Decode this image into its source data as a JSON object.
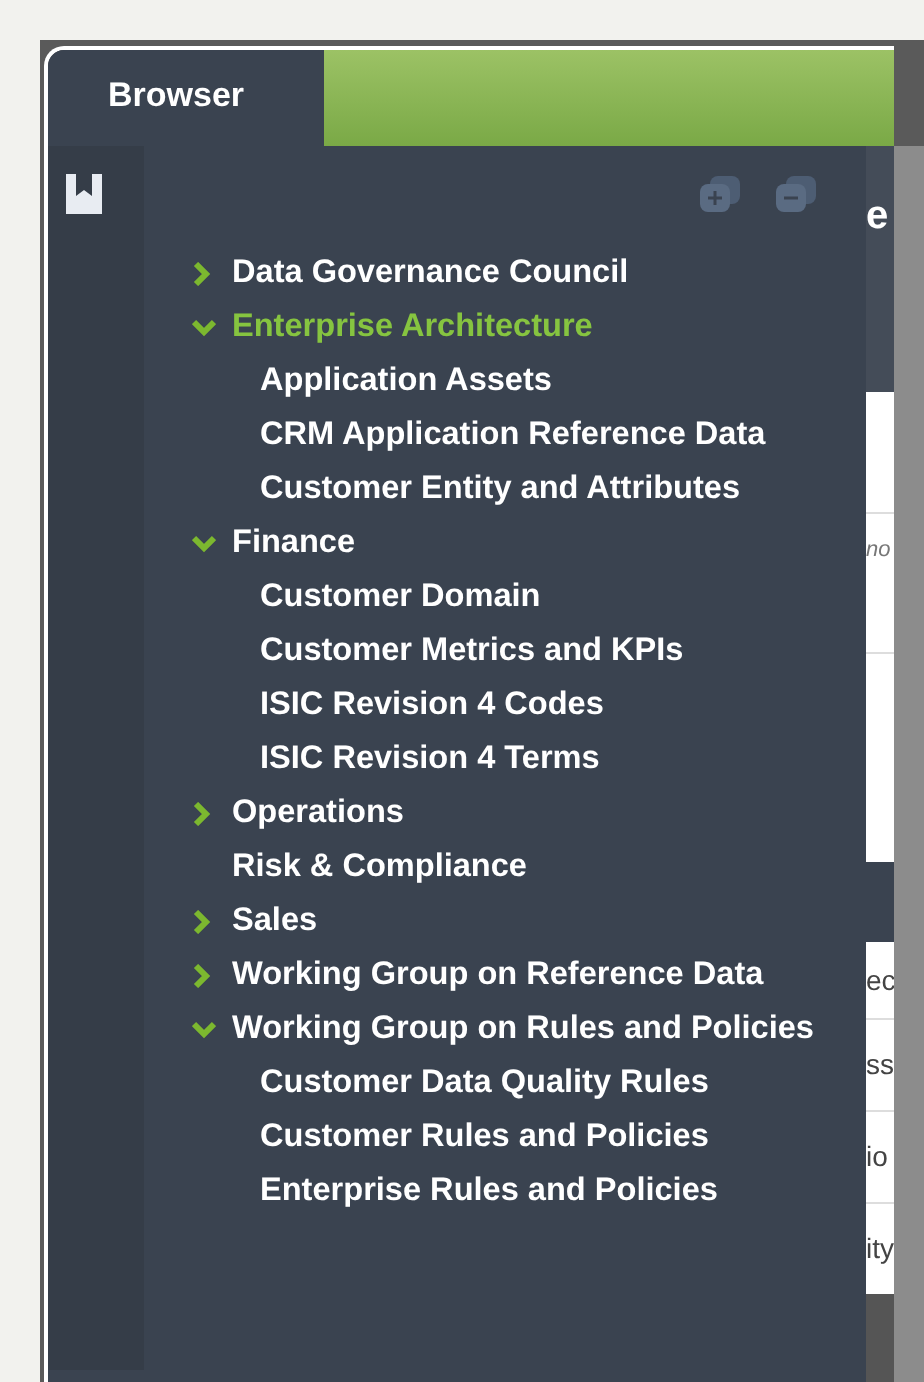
{
  "tabs": [
    {
      "label": "Browser",
      "selected": true
    }
  ],
  "tree": [
    {
      "label": "Data Governance Council",
      "expanded": false,
      "selected": false,
      "has_children": true
    },
    {
      "label": "Enterprise Architecture",
      "expanded": true,
      "selected": true,
      "has_children": true,
      "children": [
        {
          "label": "Application Assets",
          "selected": false
        },
        {
          "label": "CRM Application Reference Data",
          "selected": false
        },
        {
          "label": "Customer Entity and Attributes",
          "selected": false
        }
      ]
    },
    {
      "label": "Finance",
      "expanded": true,
      "selected": false,
      "has_children": true,
      "children": [
        {
          "label": "Customer Domain",
          "selected": false
        },
        {
          "label": "Customer Metrics and KPIs",
          "selected": false
        },
        {
          "label": "ISIC Revision 4 Codes",
          "selected": false
        },
        {
          "label": "ISIC Revision 4 Terms",
          "selected": false
        }
      ]
    },
    {
      "label": "Operations",
      "expanded": false,
      "selected": false,
      "has_children": true
    },
    {
      "label": "Risk & Compliance",
      "selected": false,
      "has_children": false
    },
    {
      "label": "Sales",
      "expanded": false,
      "selected": false,
      "has_children": true
    },
    {
      "label": "Working Group on Reference Data",
      "expanded": false,
      "selected": false,
      "has_children": true
    },
    {
      "label": "Working Group on Rules and Policies",
      "expanded": true,
      "selected": false,
      "has_children": true,
      "children": [
        {
          "label": "Customer Data Quality Rules",
          "selected": false
        },
        {
          "label": "Customer Rules and Policies",
          "selected": false
        },
        {
          "label": "Enterprise Rules and Policies",
          "selected": false
        }
      ]
    }
  ],
  "background_fragments": [
    {
      "text": "e",
      "kind": "heading"
    },
    {
      "text": "no",
      "kind": "italic"
    },
    {
      "text": "ec",
      "kind": "row"
    },
    {
      "text": "ss",
      "kind": "row"
    },
    {
      "text": "io",
      "kind": "row"
    },
    {
      "text": "ity",
      "kind": "row"
    }
  ]
}
